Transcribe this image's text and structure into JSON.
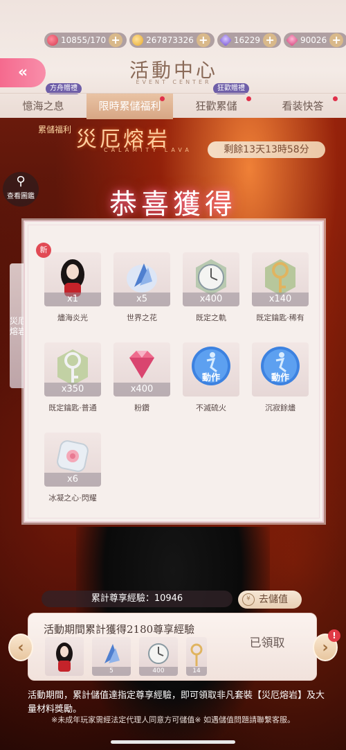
{
  "resources": [
    {
      "icon": "heart-icon",
      "value": "10855/170"
    },
    {
      "icon": "cat-coin-icon",
      "value": "267873326"
    },
    {
      "icon": "purple-diamond-icon",
      "value": "16229"
    },
    {
      "icon": "pink-diamond-icon",
      "value": "90026"
    }
  ],
  "plus_label": "+",
  "header": {
    "back_label": "«",
    "title": "活動中心",
    "title_en": "EVENT CENTER"
  },
  "tabs": [
    {
      "label": "憶海之息",
      "tag": "方舟贈禮",
      "active": false,
      "dot": false
    },
    {
      "label": "限時累儲福利",
      "tag": "",
      "active": true,
      "dot": true
    },
    {
      "label": "狂歡累儲",
      "tag": "狂歡贈禮",
      "active": false,
      "dot": true
    },
    {
      "label": "看装快答",
      "tag": "",
      "active": false,
      "dot": true
    }
  ],
  "event": {
    "badge": "累儲福利",
    "title": "災厄熔岩",
    "title_en": "CALAMITY LAVA",
    "countdown": "剩餘13天13時58分",
    "gallery_label": "查看圖鑑",
    "side_label": "災厄熔岩"
  },
  "popup": {
    "title": "恭喜獲得",
    "new_badge": "新",
    "items": [
      {
        "name": "燼海炎光",
        "qty": "x1",
        "kind": "portrait"
      },
      {
        "name": "世界之花",
        "qty": "x5",
        "kind": "blue-crystal"
      },
      {
        "name": "既定之軌",
        "qty": "x400",
        "kind": "clock"
      },
      {
        "name": "既定鑰匙·稀有",
        "qty": "x140",
        "kind": "gold-key"
      },
      {
        "name": "既定鑰匙·普通",
        "qty": "x350",
        "kind": "silver-key"
      },
      {
        "name": "粉鑽",
        "qty": "x400",
        "kind": "pink-diamond"
      },
      {
        "name": "不滅硫火",
        "qty": "",
        "kind": "action",
        "action_label": "動作"
      },
      {
        "name": "沉寂餘燼",
        "qty": "",
        "kind": "action",
        "action_label": "動作"
      },
      {
        "name": "冰凝之心·閃耀",
        "qty": "x6",
        "kind": "ice-heart"
      }
    ]
  },
  "bottom": {
    "exp_label": "累計尊享經驗：10946",
    "recharge_label": "去儲值",
    "coin_glyph": "¥",
    "milestone_title": "活動期間累計獲得2180尊享經驗",
    "claimed_label": "已領取",
    "milestone_items": [
      {
        "kind": "portrait",
        "qty": ""
      },
      {
        "kind": "blue-crystal",
        "qty": "5"
      },
      {
        "kind": "clock",
        "qty": "400"
      },
      {
        "kind": "gold-key",
        "qty": "14"
      }
    ],
    "prev_arrow": "‹",
    "next_arrow": "›",
    "alert": "!",
    "description": "活動期間，累計儲值達指定尊享經驗，即可領取非凡套裝【災厄熔岩】及大量材料獎勵。",
    "note": "※未成年玩家需經法定代理人同意方可儲值※ 如遇儲值問題請聯繫客服。"
  },
  "colors": {
    "accent_pink": "#f56a8e",
    "tab_active": "#d7a684",
    "tag_purple": "#6e5ea8",
    "alert_red": "#e03a46"
  }
}
